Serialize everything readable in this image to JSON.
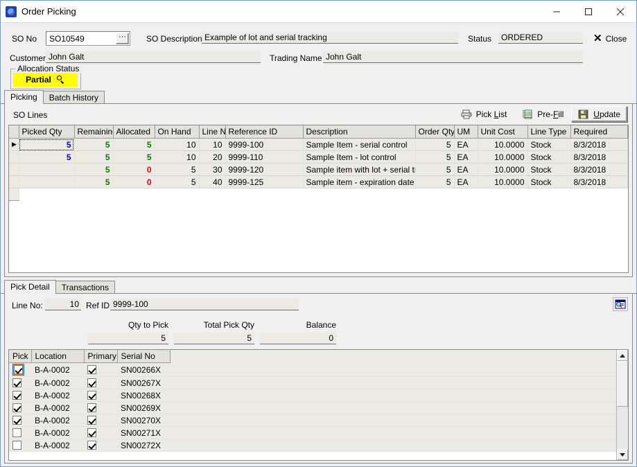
{
  "window": {
    "title": "Order Picking",
    "icon": "app-icon",
    "minimize": "—",
    "maximize": "□",
    "close": "×"
  },
  "header": {
    "so_no_label": "SO No",
    "so_no_value": "SO10549",
    "so_no_browse": "···",
    "so_desc_label": "SO Description",
    "so_desc_value": "Example of lot and serial tracking",
    "status_label": "Status",
    "status_value": "ORDERED",
    "close_label": "Close",
    "customer_label": "Customer",
    "customer_value": "John Galt",
    "trading_name_label": "Trading Name",
    "trading_name_value": "John Galt",
    "allocation_status_legend": "Allocation Status",
    "allocation_status_value": "Partial"
  },
  "tabs": [
    {
      "label": "Picking",
      "active": true
    },
    {
      "label": "Batch History",
      "active": false
    }
  ],
  "picking": {
    "section_label": "SO Lines",
    "toolbar": {
      "pick_list": "Pick List",
      "pre_fill": "Pre-Fill",
      "update": "Update"
    },
    "columns": [
      "Picked Qty",
      "Remaining",
      "Allocated",
      "On Hand",
      "Line No",
      "Reference ID",
      "Description",
      "Order Qty",
      "UM",
      "Unit Cost",
      "Line Type",
      "Required"
    ],
    "rows": [
      {
        "selected": true,
        "picked_qty": "5",
        "remaining": "5",
        "allocated": "5",
        "on_hand": "10",
        "line_no": "10",
        "reference_id": "9999-100",
        "description": "Sample Item - serial control",
        "order_qty": "5",
        "um": "EA",
        "unit_cost": "10.0000",
        "line_type": "Stock",
        "required": "8/3/2018"
      },
      {
        "selected": false,
        "picked_qty": "5",
        "remaining": "5",
        "allocated": "5",
        "on_hand": "10",
        "line_no": "20",
        "reference_id": "9999-110",
        "description": "Sample Item - lot control",
        "order_qty": "5",
        "um": "EA",
        "unit_cost": "10.0000",
        "line_type": "Stock",
        "required": "8/3/2018"
      },
      {
        "selected": false,
        "picked_qty": "",
        "remaining": "5",
        "allocated": "0",
        "on_hand": "5",
        "line_no": "30",
        "reference_id": "9999-120",
        "description": "Sample item with lot + serial tracl",
        "order_qty": "5",
        "um": "EA",
        "unit_cost": "10.0000",
        "line_type": "Stock",
        "required": "8/3/2018"
      },
      {
        "selected": false,
        "picked_qty": "",
        "remaining": "5",
        "allocated": "0",
        "on_hand": "5",
        "line_no": "40",
        "reference_id": "9999-125",
        "description": "Sample item - expiration date cor",
        "order_qty": "5",
        "um": "EA",
        "unit_cost": "10.0000",
        "line_type": "Stock",
        "required": "8/3/2018"
      }
    ]
  },
  "detail": {
    "tabs": [
      {
        "label": "Pick Detail",
        "active": true
      },
      {
        "label": "Transactions",
        "active": false
      }
    ],
    "line_no_label": "Line No:",
    "line_no_value": "10",
    "ref_id_label": "Ref ID:",
    "ref_id_value": "9999-100",
    "qty_to_pick_label": "Qty to Pick",
    "qty_to_pick_value": "5",
    "total_pick_qty_label": "Total Pick Qty",
    "total_pick_qty_value": "5",
    "balance_label": "Balance",
    "balance_value": "0",
    "columns": [
      "Pick",
      "Location",
      "Primary",
      "Serial No"
    ],
    "rows": [
      {
        "pick": true,
        "location": "B-A-0002",
        "primary": true,
        "serial_no": "SN00266X",
        "focused": true
      },
      {
        "pick": true,
        "location": "B-A-0002",
        "primary": true,
        "serial_no": "SN00267X",
        "focused": false
      },
      {
        "pick": true,
        "location": "B-A-0002",
        "primary": true,
        "serial_no": "SN00268X",
        "focused": false
      },
      {
        "pick": true,
        "location": "B-A-0002",
        "primary": true,
        "serial_no": "SN00269X",
        "focused": false
      },
      {
        "pick": true,
        "location": "B-A-0002",
        "primary": true,
        "serial_no": "SN00270X",
        "focused": false
      },
      {
        "pick": false,
        "location": "B-A-0002",
        "primary": true,
        "serial_no": "SN00271X",
        "focused": false
      },
      {
        "pick": false,
        "location": "B-A-0002",
        "primary": true,
        "serial_no": "SN00272X",
        "focused": false
      }
    ]
  },
  "colors": {
    "highlight_yellow": "#ffff00",
    "value_blue": "#0000dd",
    "value_green": "#008000",
    "value_red": "#dd0000",
    "window_border": "#7a9bc4",
    "face": "#f0f0f0"
  }
}
